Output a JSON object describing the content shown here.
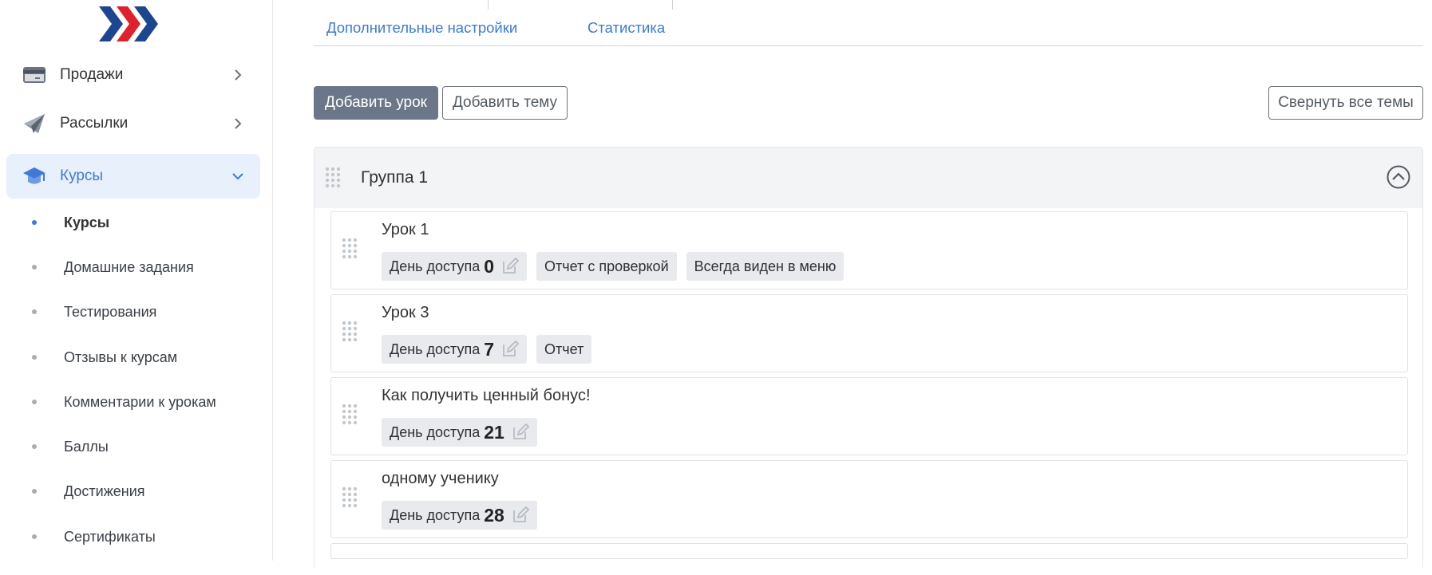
{
  "sidebar": {
    "nav": [
      {
        "label": "Продажи",
        "icon": "credit-card-icon"
      },
      {
        "label": "Рассылки",
        "icon": "paper-plane-icon"
      },
      {
        "label": "Курсы",
        "icon": "graduation-cap-icon"
      }
    ],
    "submenu": [
      {
        "label": "Курсы"
      },
      {
        "label": "Домашние задания"
      },
      {
        "label": "Тестирования"
      },
      {
        "label": "Отзывы к курсам"
      },
      {
        "label": "Комментарии к урокам"
      },
      {
        "label": "Баллы"
      },
      {
        "label": "Достижения"
      },
      {
        "label": "Сертификаты"
      }
    ]
  },
  "tabs": [
    {
      "label": "Дополнительные настройки"
    },
    {
      "label": "Статистика"
    }
  ],
  "toolbar": {
    "add_lesson": "Добавить урок",
    "add_topic": "Добавить тему",
    "collapse_all": "Свернуть все темы"
  },
  "group": {
    "title": "Группа 1",
    "lessons": [
      {
        "title": "Урок 1",
        "access_label": "День доступа",
        "access_day": "0",
        "tags": [
          "Отчет с проверкой",
          "Всегда виден в меню"
        ]
      },
      {
        "title": "Урок 3",
        "access_label": "День доступа",
        "access_day": "7",
        "tags": [
          "Отчет"
        ]
      },
      {
        "title": "Как получить ценный бонус!",
        "access_label": "День доступа",
        "access_day": "21",
        "tags": []
      },
      {
        "title": "одному ученику",
        "access_label": "День доступа",
        "access_day": "28",
        "tags": []
      }
    ]
  },
  "colors": {
    "accent": "#3e7ad6",
    "primary_button": "#6b7789",
    "logo_blue": "#1d4690",
    "logo_red": "#e0202b"
  }
}
